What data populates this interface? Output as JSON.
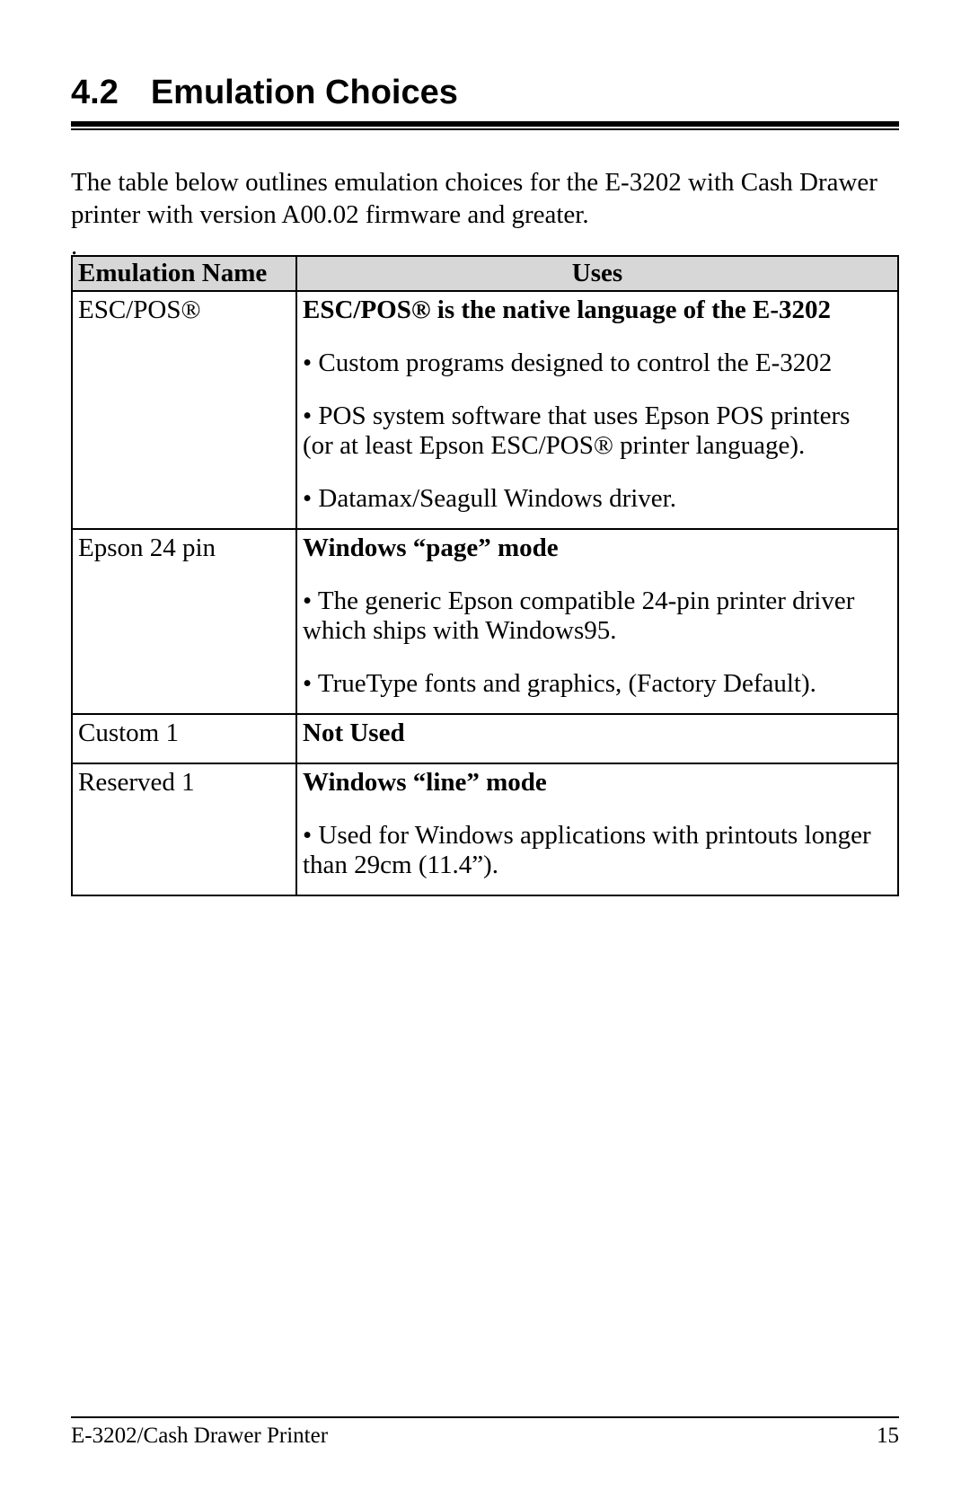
{
  "heading": {
    "number": "4.2",
    "title": "Emulation Choices"
  },
  "intro": "The table below outlines emulation choices for the E-3202 with Cash Drawer printer with version A00.02 firmware and greater.",
  "dot": ".",
  "table": {
    "headers": {
      "name": "Emulation Name",
      "uses": "Uses"
    },
    "rows": [
      {
        "name": "ESC/POS®",
        "uses_head": "ESC/POS® is the native language of the E-3202",
        "bullets": [
          "• Custom programs designed to control the E-3202",
          "• POS system software that uses Epson POS printers (or at least Epson ESC/POS® printer language).",
          "• Datamax/Seagull Windows driver."
        ]
      },
      {
        "name": "Epson 24 pin",
        "uses_head": "Windows “page” mode",
        "bullets": [
          "• The generic Epson compatible 24-pin printer driver which ships with Windows95.",
          "• TrueType fonts and graphics, (Factory Default)."
        ]
      },
      {
        "name": "Custom 1",
        "uses_head": "Not Used",
        "bullets": []
      },
      {
        "name": "Reserved 1",
        "uses_head": "Windows “line” mode",
        "bullets": [
          "• Used for Windows applications with printouts longer than 29cm (11.4”)."
        ]
      }
    ]
  },
  "footer": {
    "left": "E-3202/Cash Drawer Printer",
    "right": "15"
  }
}
